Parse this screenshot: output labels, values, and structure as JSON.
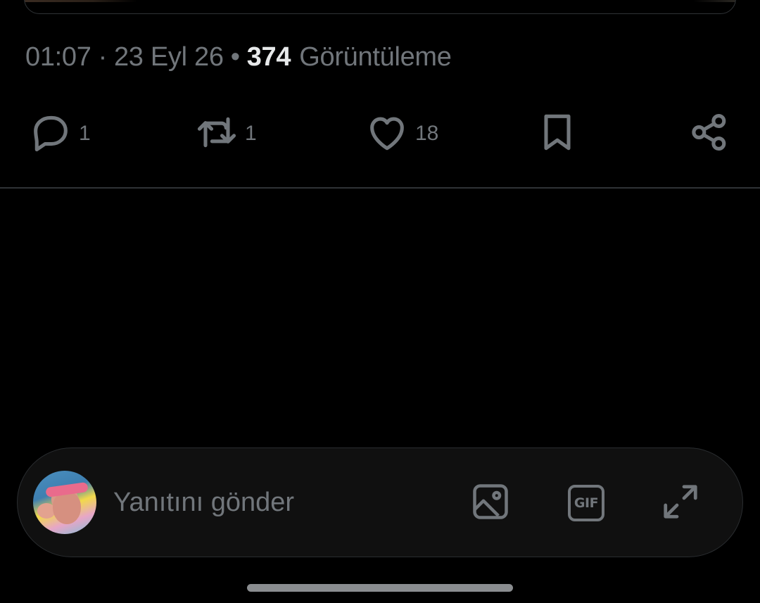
{
  "tweet": {
    "time": "01:07",
    "separator": "·",
    "date": "23 Eyl 26",
    "separator2": "•",
    "views_count": "374",
    "views_label": "Görüntüleme"
  },
  "actions": {
    "reply": {
      "icon": "reply-icon",
      "count": "1"
    },
    "retweet": {
      "icon": "retweet-icon",
      "count": "1"
    },
    "like": {
      "icon": "heart-icon",
      "count": "18"
    },
    "bookmark": {
      "icon": "bookmark-icon"
    },
    "share": {
      "icon": "share-icon"
    }
  },
  "composer": {
    "placeholder": "Yanıtını gönder",
    "gif_label": "GIF",
    "buttons": [
      "image-icon",
      "gif-icon",
      "expand-icon"
    ]
  },
  "colors": {
    "background": "#000000",
    "muted_text": "#71767b",
    "primary_text": "#e7e9ea",
    "divider": "#2f3336",
    "composer_bg": "#101010"
  }
}
